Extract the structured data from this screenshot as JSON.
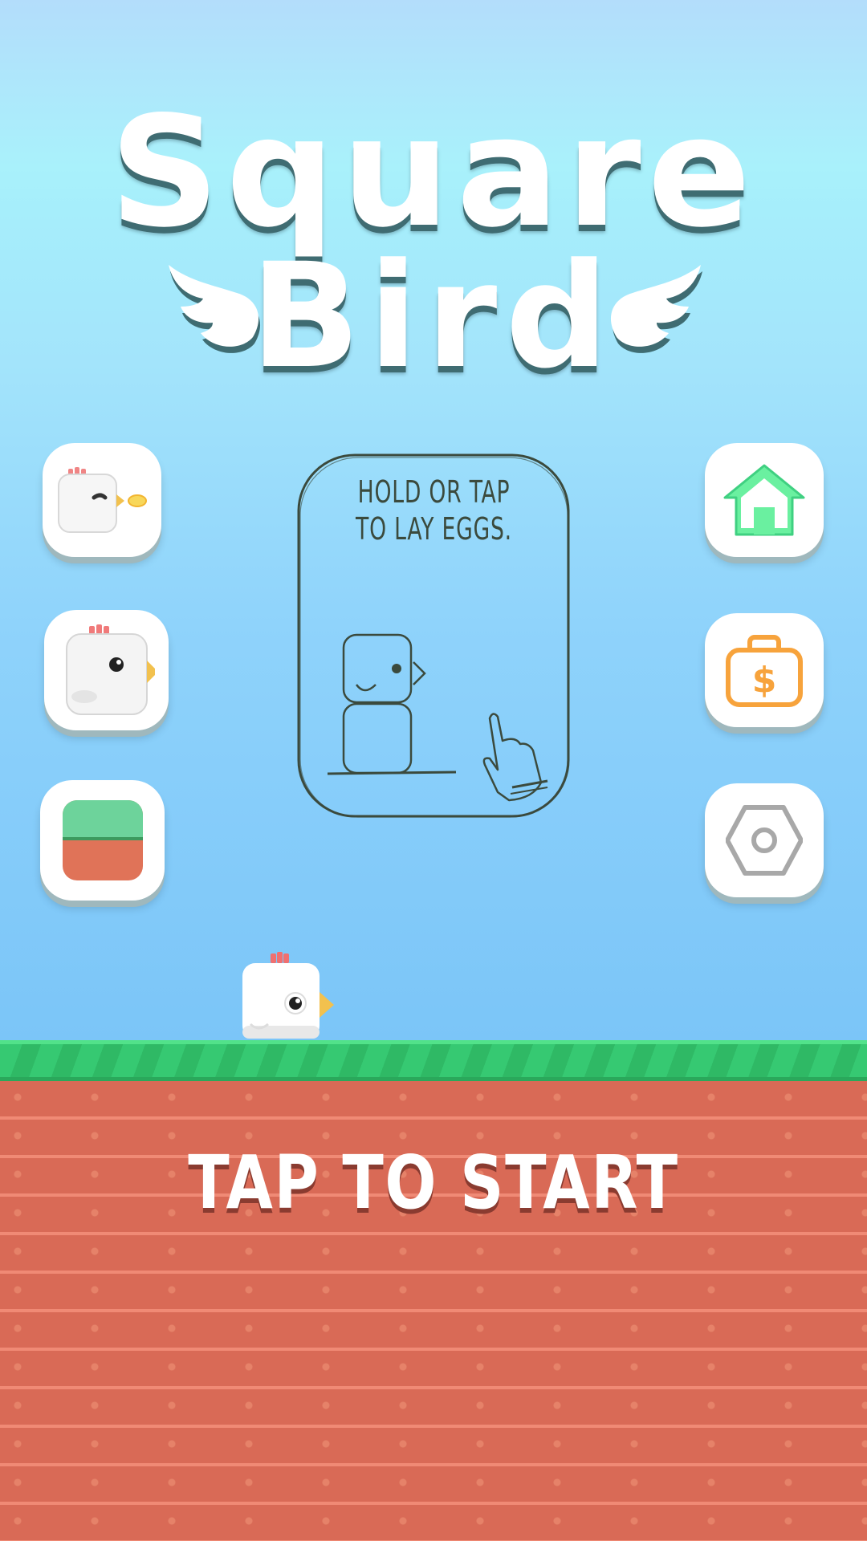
{
  "title": {
    "line1": "Square",
    "line2": "Bird"
  },
  "tutorial": {
    "line1": "HOLD OR TAP",
    "line2": "TO LAY EGGS."
  },
  "start_label": "TAP TO START",
  "icons": {
    "left": [
      "sound-chick-icon",
      "character-select-icon",
      "theme-select-icon"
    ],
    "right": [
      "home-icon",
      "shop-money-bag-icon",
      "settings-gear-icon"
    ]
  },
  "colors": {
    "sky_top": "#b3ddfb",
    "sky_bottom": "#7bc5f8",
    "grass": "#36c972",
    "dirt": "#d96a56",
    "home_green": "#6af0a0",
    "shop_orange": "#f7a33c",
    "settings_gray": "#a8a8a8"
  }
}
